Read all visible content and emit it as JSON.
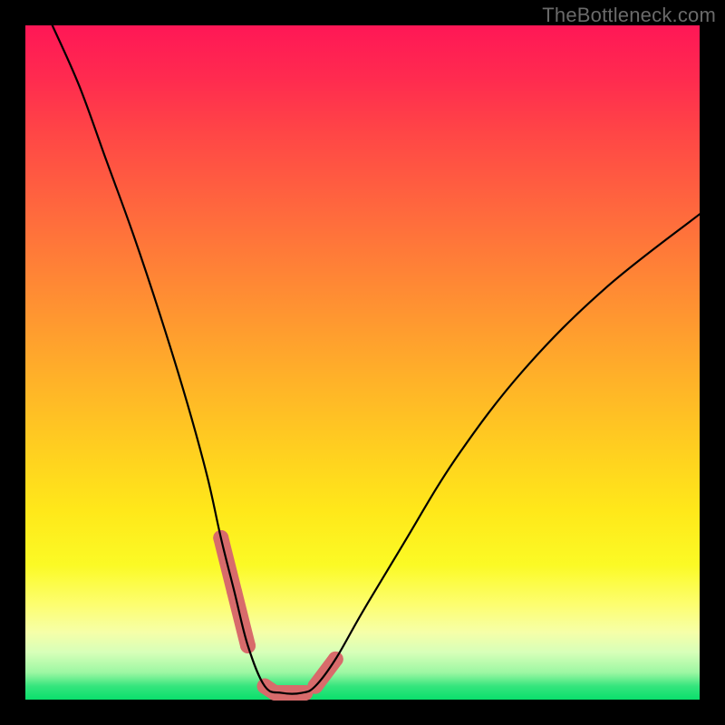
{
  "watermark": "TheBottleneck.com",
  "chart_data": {
    "type": "line",
    "title": "",
    "xlabel": "",
    "ylabel": "",
    "xlim": [
      0,
      100
    ],
    "ylim": [
      0,
      100
    ],
    "series": [
      {
        "name": "bottleneck-curve",
        "x": [
          4,
          8,
          12,
          16,
          20,
          24,
          27,
          29,
          31,
          33,
          35.5,
          38,
          41,
          43,
          46,
          50,
          56,
          64,
          74,
          86,
          100
        ],
        "y": [
          100,
          91,
          80,
          69,
          57,
          44,
          33,
          24,
          16,
          8,
          2,
          1,
          1,
          2,
          6,
          13,
          23,
          36,
          49,
          61,
          72
        ]
      }
    ],
    "markers": [
      {
        "name": "left-transition-marker",
        "points": [
          {
            "x": 29,
            "y": 24
          },
          {
            "x": 31,
            "y": 16
          },
          {
            "x": 33,
            "y": 8
          }
        ]
      },
      {
        "name": "right-transition-marker",
        "points": [
          {
            "x": 43,
            "y": 2
          },
          {
            "x": 46,
            "y": 6
          }
        ]
      },
      {
        "name": "bottom-flat-marker",
        "points": [
          {
            "x": 35.5,
            "y": 2
          },
          {
            "x": 37,
            "y": 1
          },
          {
            "x": 38.5,
            "y": 1
          },
          {
            "x": 40,
            "y": 1
          },
          {
            "x": 41.5,
            "y": 1
          }
        ]
      }
    ],
    "marker_color": "#d86b6b",
    "curve_color": "#000000"
  }
}
